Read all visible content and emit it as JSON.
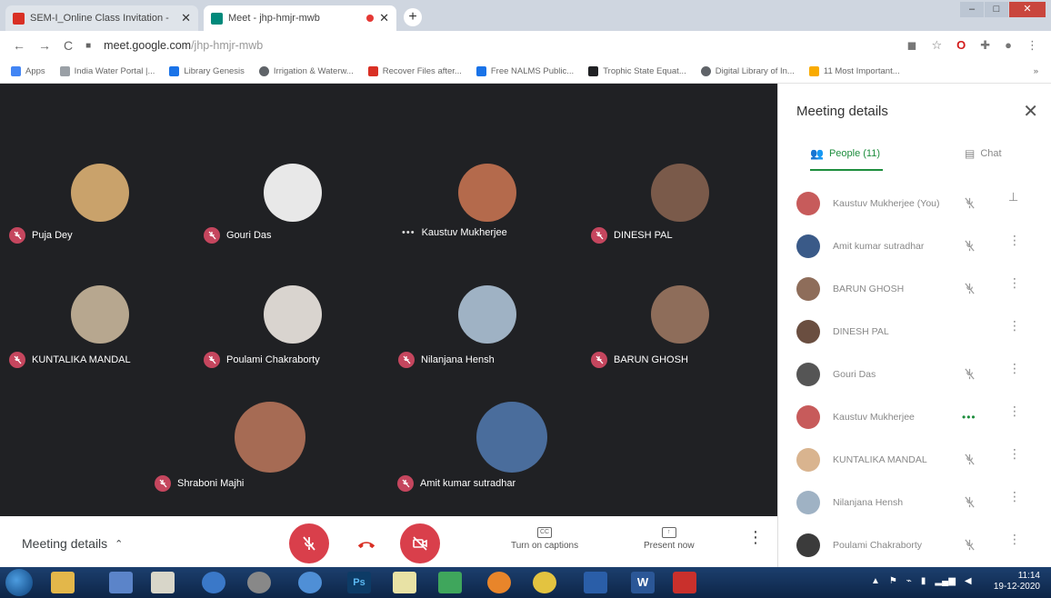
{
  "browser": {
    "tabs": [
      {
        "title": "SEM-I_Online Class Invitation -",
        "active": false,
        "favicon_color": "#d93025"
      },
      {
        "title": "Meet - jhp-hmjr-mwb",
        "active": true,
        "favicon_color": "#00897b"
      }
    ],
    "address": {
      "host": "meet.google.com",
      "path": "/jhp-hmjr-mwb"
    },
    "bookmarks": [
      {
        "label": "Apps",
        "color": "#4285f4"
      },
      {
        "label": "India Water Portal |...",
        "color": "#9aa0a6"
      },
      {
        "label": "Library Genesis",
        "color": "#1a73e8"
      },
      {
        "label": "Irrigation & Waterw...",
        "color": "#5f6368"
      },
      {
        "label": "Recover Files after...",
        "color": "#d93025"
      },
      {
        "label": "Free NALMS Public...",
        "color": "#1a73e8"
      },
      {
        "label": "Trophic State Equat...",
        "color": "#202124"
      },
      {
        "label": "Digital Library of In...",
        "color": "#5f6368"
      },
      {
        "label": "11 Most Important...",
        "color": "#f9ab00"
      }
    ],
    "bookmarks_more": "»"
  },
  "stage": {
    "participants": [
      {
        "name": "Puja Dey",
        "muted": true,
        "avatar_color": "#c9a26b"
      },
      {
        "name": "Gouri Das",
        "muted": true,
        "avatar_color": "#e8e8e8"
      },
      {
        "name": "Kaustuv Mukherjee",
        "muted": false,
        "avatar_color": "#b46a4c"
      },
      {
        "name": "DINESH PAL",
        "muted": true,
        "avatar_color": "#7a5a4a"
      },
      {
        "name": "KUNTALIKA MANDAL",
        "muted": true,
        "avatar_color": "#b7a78f"
      },
      {
        "name": "Poulami Chakraborty",
        "muted": true,
        "avatar_color": "#d9d4cf"
      },
      {
        "name": "Nilanjana Hensh",
        "muted": true,
        "avatar_color": "#9fb2c4"
      },
      {
        "name": "BARUN GHOSH",
        "muted": true,
        "avatar_color": "#8e6d5a"
      },
      {
        "name": "Shraboni Majhi",
        "muted": true,
        "avatar_color": "#a66b54"
      },
      {
        "name": "Amit kumar sutradhar",
        "muted": true,
        "avatar_color": "#4a6d9c"
      }
    ]
  },
  "controls": {
    "meeting_details": "Meeting details",
    "captions_label": "Turn on captions",
    "captions_icon": "CC",
    "present_label": "Present now"
  },
  "panel": {
    "title": "Meeting details",
    "tab_people": "People (11)",
    "tab_chat": "Chat",
    "people": [
      {
        "name": "Kaustuv Mukherjee (You)",
        "status": "muted",
        "action": "pin",
        "avatar_color": "#c75b5b"
      },
      {
        "name": "Amit kumar sutradhar",
        "status": "muted",
        "action": "more",
        "avatar_color": "#3a5a88"
      },
      {
        "name": "BARUN GHOSH",
        "status": "muted",
        "action": "more",
        "avatar_color": "#8e6d5a"
      },
      {
        "name": "DINESH PAL",
        "status": "none",
        "action": "more",
        "avatar_color": "#6a4e40"
      },
      {
        "name": "Gouri Das",
        "status": "muted",
        "action": "more",
        "avatar_color": "#555555"
      },
      {
        "name": "Kaustuv Mukherjee",
        "status": "speaking",
        "action": "more",
        "avatar_color": "#c75b5b"
      },
      {
        "name": "KUNTALIKA MANDAL",
        "status": "muted",
        "action": "more",
        "avatar_color": "#d9b48f"
      },
      {
        "name": "Nilanjana Hensh",
        "status": "muted",
        "action": "more",
        "avatar_color": "#9fb2c4"
      },
      {
        "name": "Poulami Chakraborty",
        "status": "muted",
        "action": "more",
        "avatar_color": "#3b3b3b"
      }
    ]
  },
  "taskbar": {
    "apps": [
      {
        "name": "file-explorer",
        "color": "#e3b74a"
      },
      {
        "name": "media-player",
        "color": "#5b84c9"
      },
      {
        "name": "paint-app",
        "color": "#d8d6c9"
      },
      {
        "name": "google-earth",
        "color": "#3a78c8"
      },
      {
        "name": "app-generic",
        "color": "#888888"
      },
      {
        "name": "magnifier",
        "color": "#4f8fd6"
      },
      {
        "name": "photoshop",
        "color": "#0d3b66",
        "label": "Ps"
      },
      {
        "name": "notepad",
        "color": "#e8e2a5"
      },
      {
        "name": "excel-like",
        "color": "#3fa65c"
      },
      {
        "name": "firefox",
        "color": "#e8852a"
      },
      {
        "name": "chrome",
        "color": "#e3c340"
      },
      {
        "name": "wave-app",
        "color": "#2a5ea8"
      },
      {
        "name": "word",
        "color": "#2b5797",
        "label": "W"
      },
      {
        "name": "acrobat",
        "color": "#c9302c"
      }
    ],
    "time": "11:14",
    "date": "19-12-2020"
  }
}
